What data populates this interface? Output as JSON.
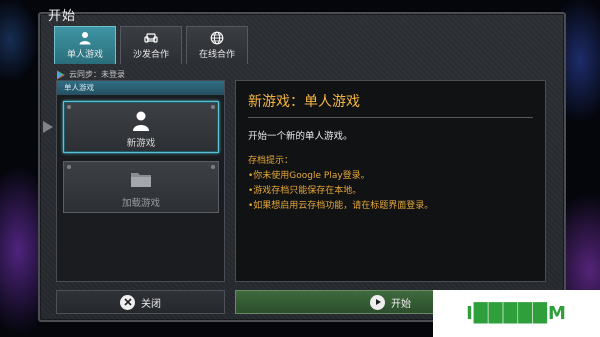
{
  "window": {
    "title": "开始"
  },
  "tabs": [
    {
      "label": "单人游戏",
      "icon": "person-icon",
      "active": true
    },
    {
      "label": "沙发合作",
      "icon": "sofa-icon",
      "active": false
    },
    {
      "label": "在线合作",
      "icon": "globe-icon",
      "active": false
    }
  ],
  "sync": {
    "icon": "google-play-icon",
    "text": "云同步：未登录"
  },
  "left_panel": {
    "header": "单人游戏",
    "slots": [
      {
        "label": "新游戏",
        "icon": "person-icon",
        "selected": true
      },
      {
        "label": "加载游戏",
        "icon": "folder-icon",
        "selected": false
      }
    ]
  },
  "detail": {
    "title": "新游戏：单人游戏",
    "description": "开始一个新的单人游戏。",
    "notes_heading": "存档提示：",
    "notes": [
      "•你未使用Google Play登录。",
      "•游戏存档只能保存在本地。",
      "•如果想启用云存档功能，请在标题界面登录。"
    ]
  },
  "buttons": {
    "close_label": "关闭",
    "close_icon": "x-icon",
    "start_label": "开始",
    "start_icon": "play-icon"
  },
  "watermark": {
    "text": "I█████M"
  },
  "colors": {
    "accent_tab": "#3f95a4",
    "selected_outline": "#59c3d6",
    "title_gold": "#f5b542",
    "note_orange": "#e7a838",
    "start_green": "#3e6a3c"
  }
}
